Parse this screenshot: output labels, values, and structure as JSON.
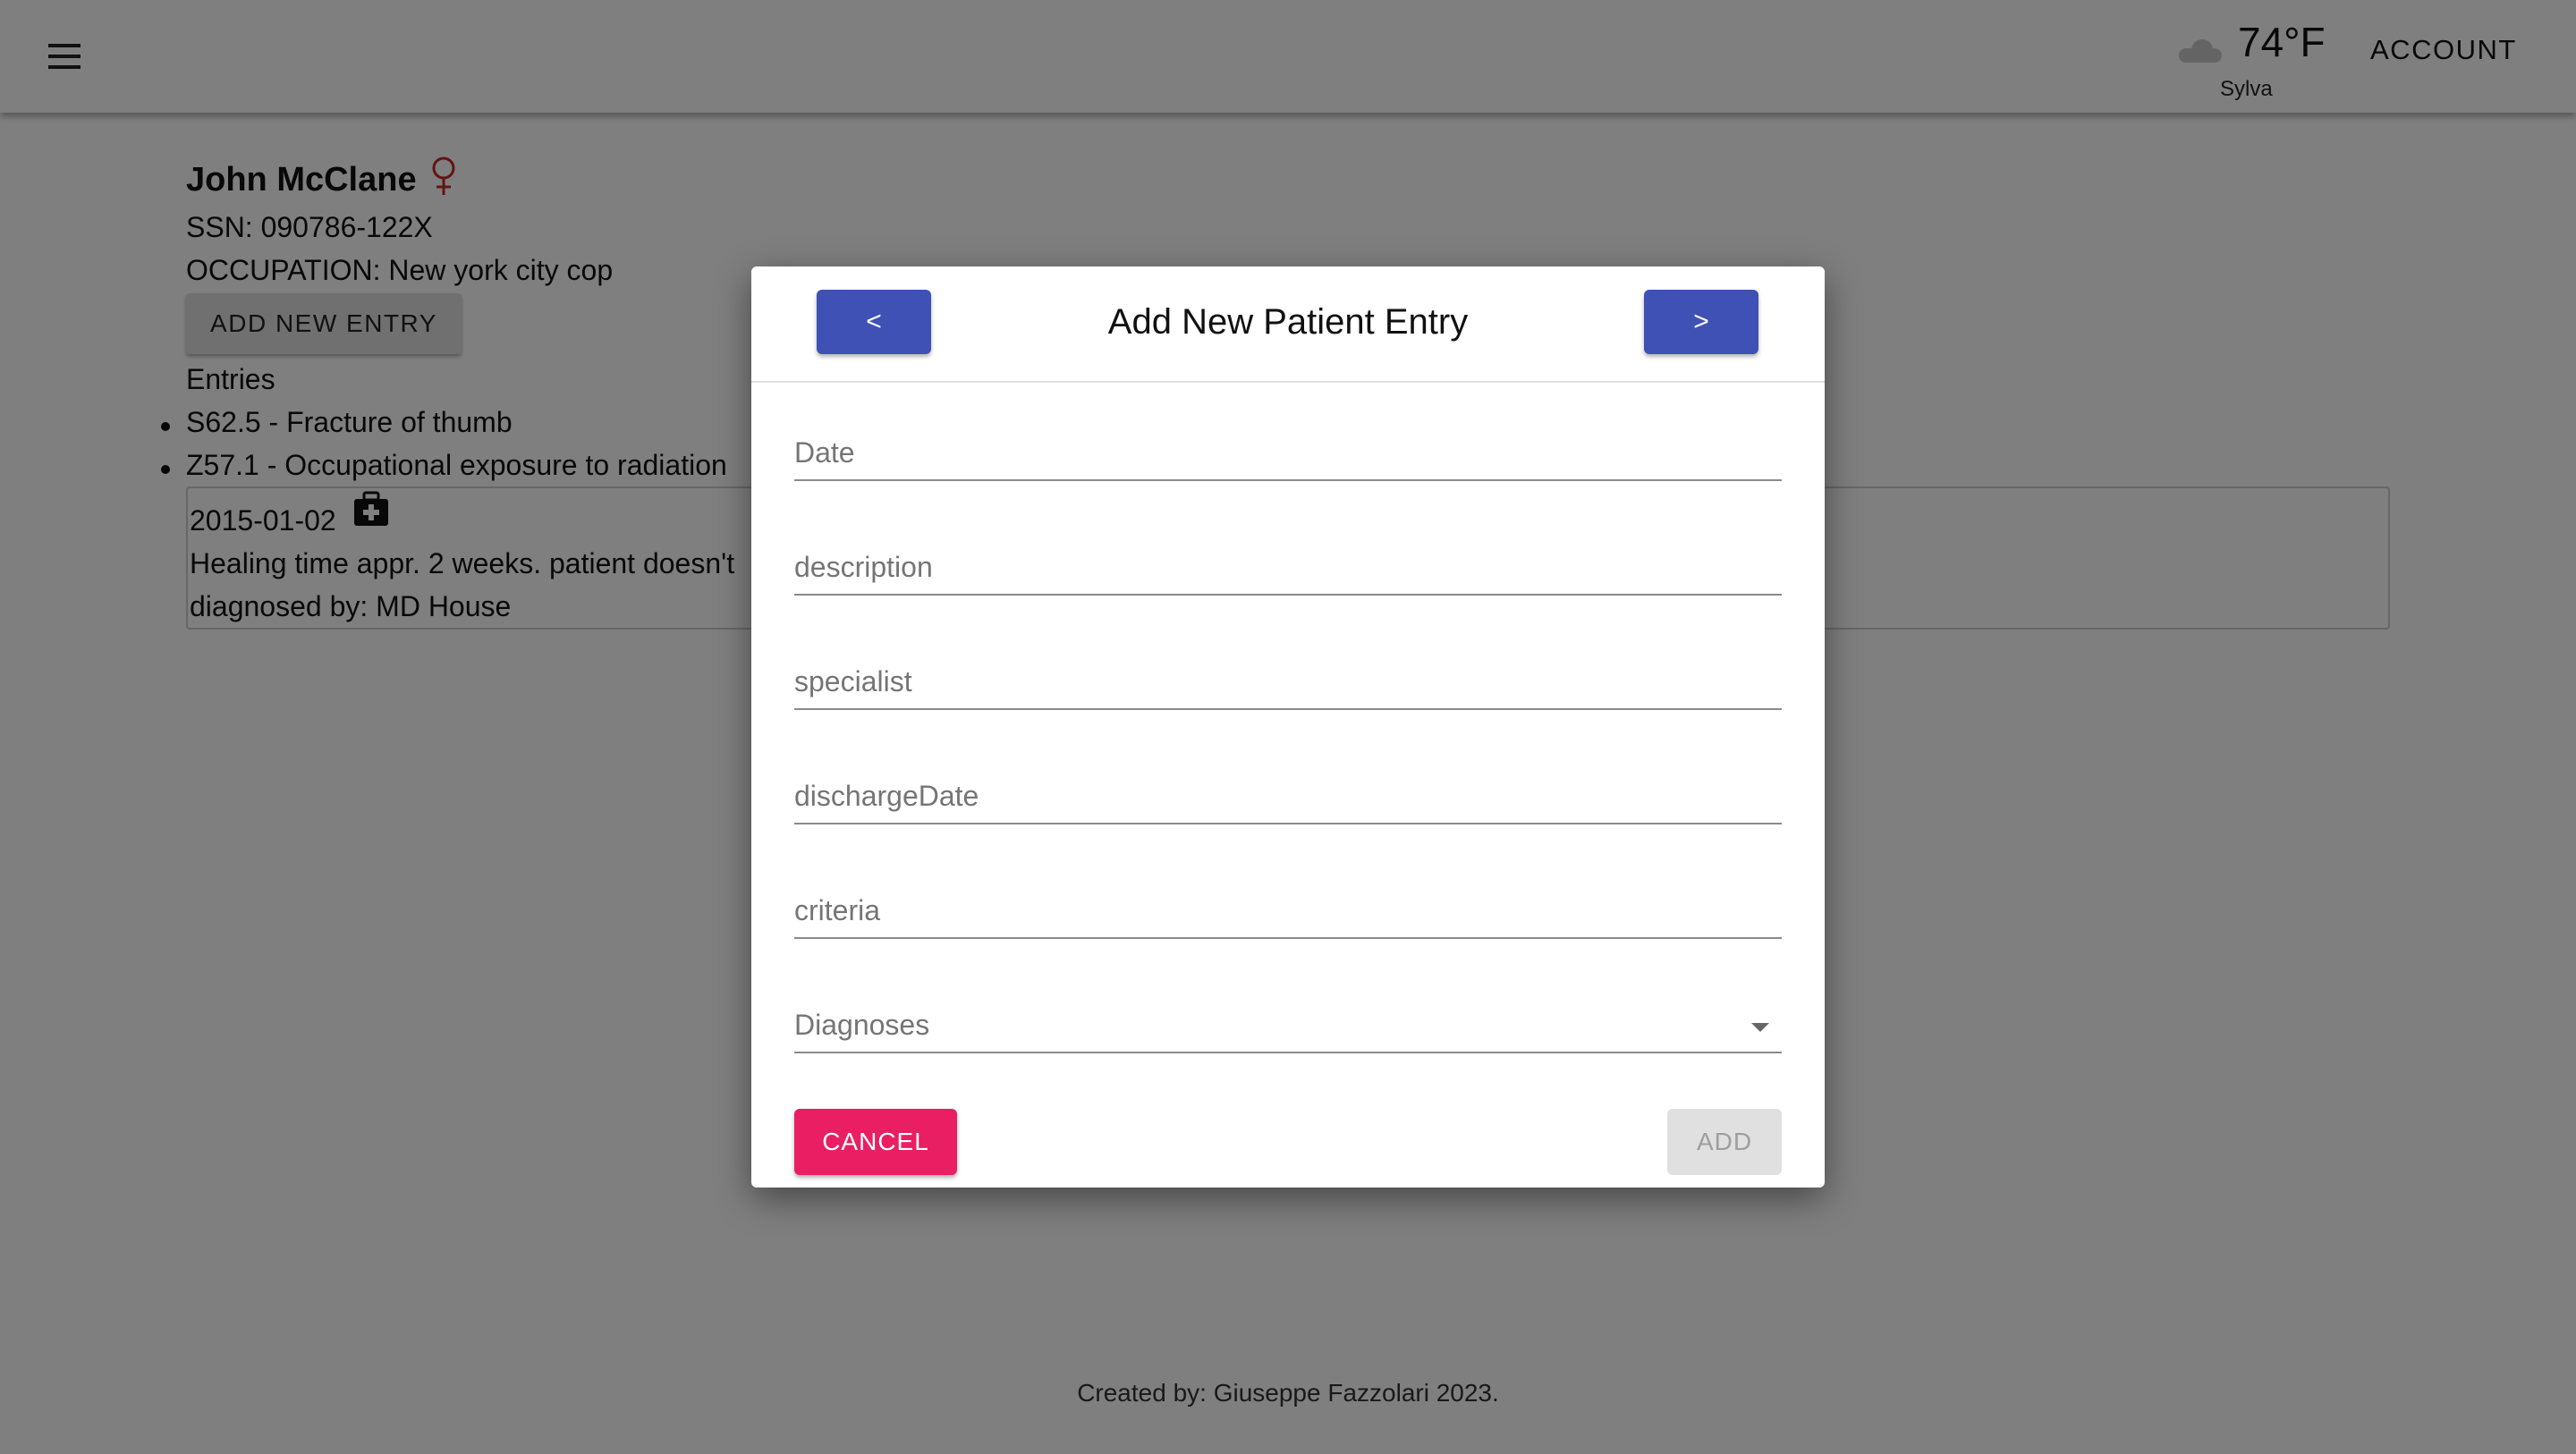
{
  "header": {
    "menu_icon": "menu-icon",
    "weather": {
      "icon": "cloud-icon",
      "temperature": "74°F",
      "location": "Sylva"
    },
    "account_label": "ACCOUNT"
  },
  "patient": {
    "name": "John McClane",
    "gender_icon": "female-icon",
    "ssn": "SSN: 090786-122X",
    "occupation": "OCCUPATION: New york city cop",
    "add_entry_label": "ADD NEW ENTRY",
    "entries_title": "Entries",
    "diagnoses": [
      "S62.5 - Fracture of thumb",
      "Z57.1 - Occupational exposure to radiation"
    ],
    "entry": {
      "date": "2015-01-02",
      "icon": "medical-bag-icon",
      "description": "Healing time appr. 2 weeks. patient doesn't",
      "diagnosed_by": "diagnosed by: MD House"
    }
  },
  "footer": {
    "text": "Created by: Giuseppe Fazzolari 2023."
  },
  "dialog": {
    "title": "Add New Patient Entry",
    "prev_label": "<",
    "next_label": ">",
    "fields": {
      "date": "Date",
      "description": "description",
      "specialist": "specialist",
      "discharge_date": "dischargeDate",
      "criteria": "criteria",
      "diagnoses": "Diagnoses"
    },
    "cancel_label": "CANCEL",
    "add_label": "ADD"
  },
  "colors": {
    "primary": "#3f51b5",
    "secondary": "#e91e63",
    "gender_icon": "#c62828",
    "backdrop": "rgba(0,0,0,0.5)"
  }
}
